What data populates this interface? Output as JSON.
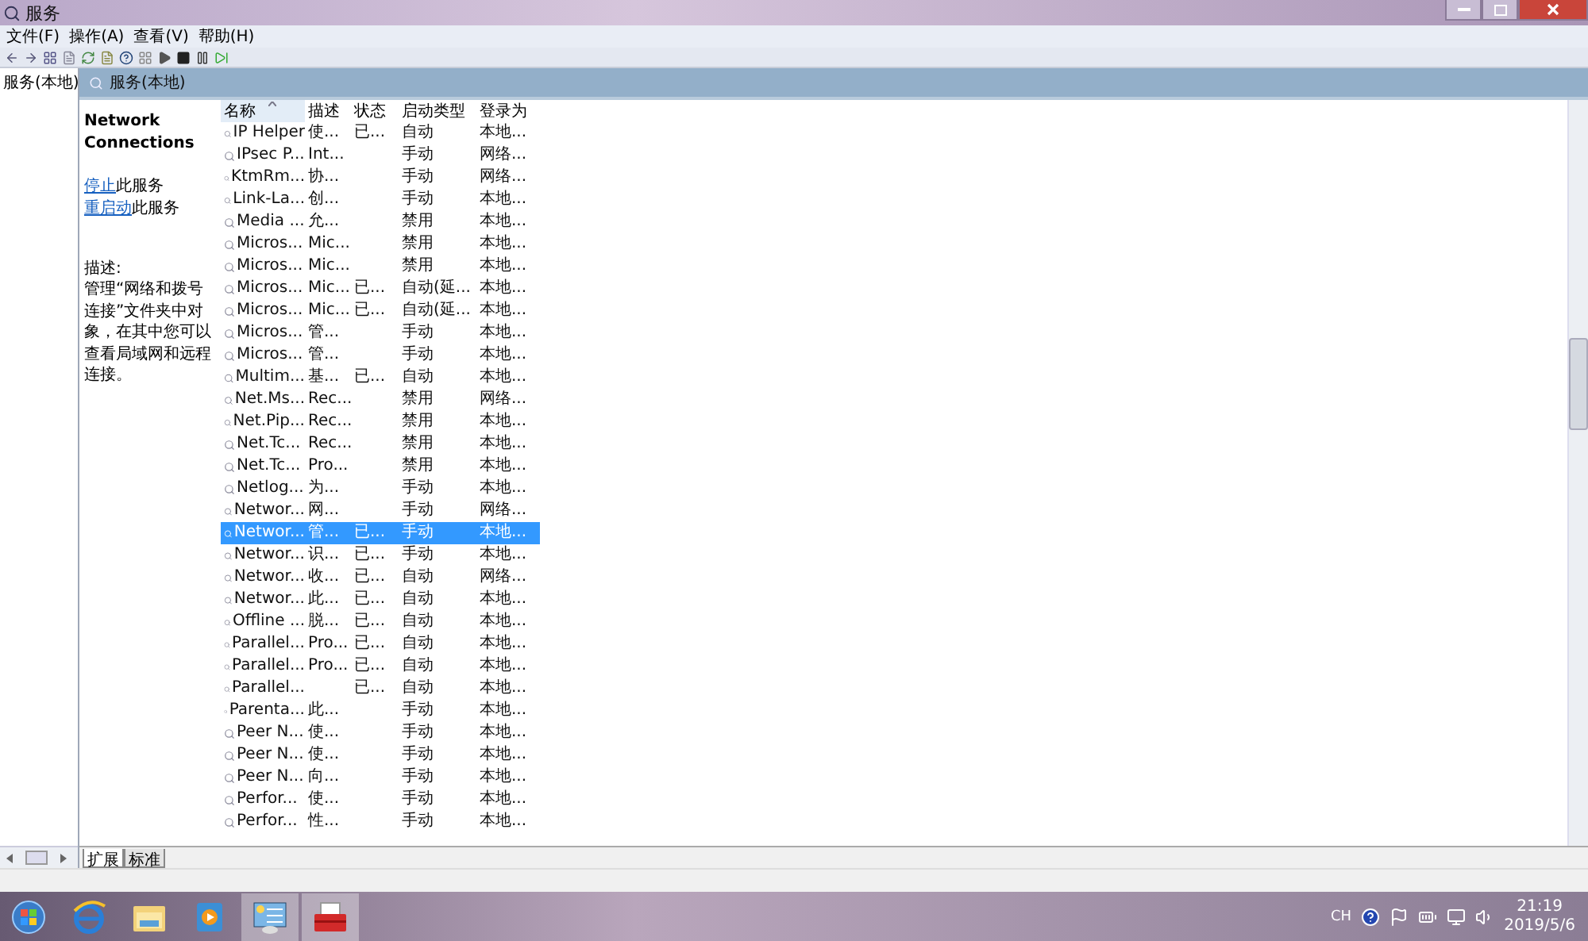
{
  "window": {
    "title": "服务"
  },
  "menu": [
    "文件(F)",
    "操作(A)",
    "查看(V)",
    "帮助(H)"
  ],
  "tree": {
    "items": [
      {
        "label": "服务(本地)",
        "selected": false
      }
    ]
  },
  "pane_header": "服务(本地)",
  "details": {
    "title": "Network Connections",
    "actions": [
      {
        "link": "停止",
        "rest": "此服务"
      },
      {
        "link": "重启动",
        "rest": "此服务"
      }
    ],
    "description_label": "描述:",
    "description": "管理“网络和拨号连接”文件夹中对象，在其中您可以查看局域网和远程连接。"
  },
  "table": {
    "columns": [
      {
        "label": "名称",
        "sorted": true
      },
      {
        "label": "描述",
        "sorted": false
      },
      {
        "label": "状态",
        "sorted": false
      },
      {
        "label": "启动类型",
        "sorted": false
      },
      {
        "label": "登录为",
        "sorted": false
      }
    ],
    "rows": [
      {
        "name": "IP Helper",
        "desc": "使...",
        "status": "已...",
        "startup": "自动",
        "logon": "本地...",
        "selected": false
      },
      {
        "name": "IPsec P...",
        "desc": "Int...",
        "startup": "手动",
        "logon": "网络...",
        "selected": false
      },
      {
        "name": "KtmRm...",
        "desc": "协...",
        "startup": "手动",
        "logon": "网络...",
        "selected": false
      },
      {
        "name": "Link-La...",
        "desc": "创...",
        "startup": "手动",
        "logon": "本地...",
        "selected": false
      },
      {
        "name": "Media ...",
        "desc": "允...",
        "startup": "禁用",
        "logon": "本地...",
        "selected": false
      },
      {
        "name": "Micros...",
        "desc": "Mic...",
        "startup": "禁用",
        "logon": "本地...",
        "selected": false
      },
      {
        "name": "Micros...",
        "desc": "Mic...",
        "startup": "禁用",
        "logon": "本地...",
        "selected": false
      },
      {
        "name": "Micros...",
        "desc": "Mic...",
        "status": "已...",
        "startup": "自动(延...",
        "logon": "本地...",
        "selected": false
      },
      {
        "name": "Micros...",
        "desc": "Mic...",
        "status": "已...",
        "startup": "自动(延...",
        "logon": "本地...",
        "selected": false
      },
      {
        "name": "Micros...",
        "desc": "管...",
        "startup": "手动",
        "logon": "本地...",
        "selected": false
      },
      {
        "name": "Micros...",
        "desc": "管...",
        "startup": "手动",
        "logon": "本地...",
        "selected": false
      },
      {
        "name": "Multim...",
        "desc": "基...",
        "status": "已...",
        "startup": "自动",
        "logon": "本地...",
        "selected": false
      },
      {
        "name": "Net.Ms...",
        "desc": "Rec...",
        "startup": "禁用",
        "logon": "网络...",
        "selected": false
      },
      {
        "name": "Net.Pip...",
        "desc": "Rec...",
        "startup": "禁用",
        "logon": "本地...",
        "selected": false
      },
      {
        "name": "Net.Tc...",
        "desc": "Rec...",
        "startup": "禁用",
        "logon": "本地...",
        "selected": false
      },
      {
        "name": "Net.Tc...",
        "desc": "Pro...",
        "startup": "禁用",
        "logon": "本地...",
        "selected": false
      },
      {
        "name": "Netlog...",
        "desc": "为...",
        "startup": "手动",
        "logon": "本地...",
        "selected": false
      },
      {
        "name": "Networ...",
        "desc": "网...",
        "startup": "手动",
        "logon": "网络...",
        "selected": false
      },
      {
        "name": "Networ...",
        "desc": "管...",
        "status": "已...",
        "startup": "手动",
        "logon": "本地...",
        "selected": true
      },
      {
        "name": "Networ...",
        "desc": "识...",
        "status": "已...",
        "startup": "手动",
        "logon": "本地...",
        "selected": false
      },
      {
        "name": "Networ...",
        "desc": "收...",
        "status": "已...",
        "startup": "自动",
        "logon": "网络...",
        "selected": false
      },
      {
        "name": "Networ...",
        "desc": "此...",
        "status": "已...",
        "startup": "自动",
        "logon": "本地...",
        "selected": false
      },
      {
        "name": "Offline ...",
        "desc": "脱...",
        "status": "已...",
        "startup": "自动",
        "logon": "本地...",
        "selected": false
      },
      {
        "name": "Parallel...",
        "desc": "Pro...",
        "status": "已...",
        "startup": "自动",
        "logon": "本地...",
        "selected": false
      },
      {
        "name": "Parallel...",
        "desc": "Pro...",
        "status": "已...",
        "startup": "自动",
        "logon": "本地...",
        "selected": false
      },
      {
        "name": "Parallel...",
        "status": "已...",
        "startup": "自动",
        "logon": "本地...",
        "selected": false
      },
      {
        "name": "Parenta...",
        "desc": "此...",
        "startup": "手动",
        "logon": "本地...",
        "selected": false
      },
      {
        "name": "Peer N...",
        "desc": "使...",
        "startup": "手动",
        "logon": "本地...",
        "selected": false
      },
      {
        "name": "Peer N...",
        "desc": "使...",
        "startup": "手动",
        "logon": "本地...",
        "selected": false
      },
      {
        "name": "Peer N...",
        "desc": "向...",
        "startup": "手动",
        "logon": "本地...",
        "selected": false
      },
      {
        "name": "Perfor...",
        "desc": "使...",
        "startup": "手动",
        "logon": "本地...",
        "selected": false
      },
      {
        "name": "Perfor...",
        "desc": "性...",
        "startup": "手动",
        "logon": "本地...",
        "selected": false
      }
    ]
  },
  "view_tabs": [
    {
      "label": "扩展",
      "selected": true
    },
    {
      "label": "标准",
      "selected": false
    }
  ],
  "taskbar": {
    "language": "CH",
    "time": "21:19",
    "date": "2019/5/6"
  }
}
